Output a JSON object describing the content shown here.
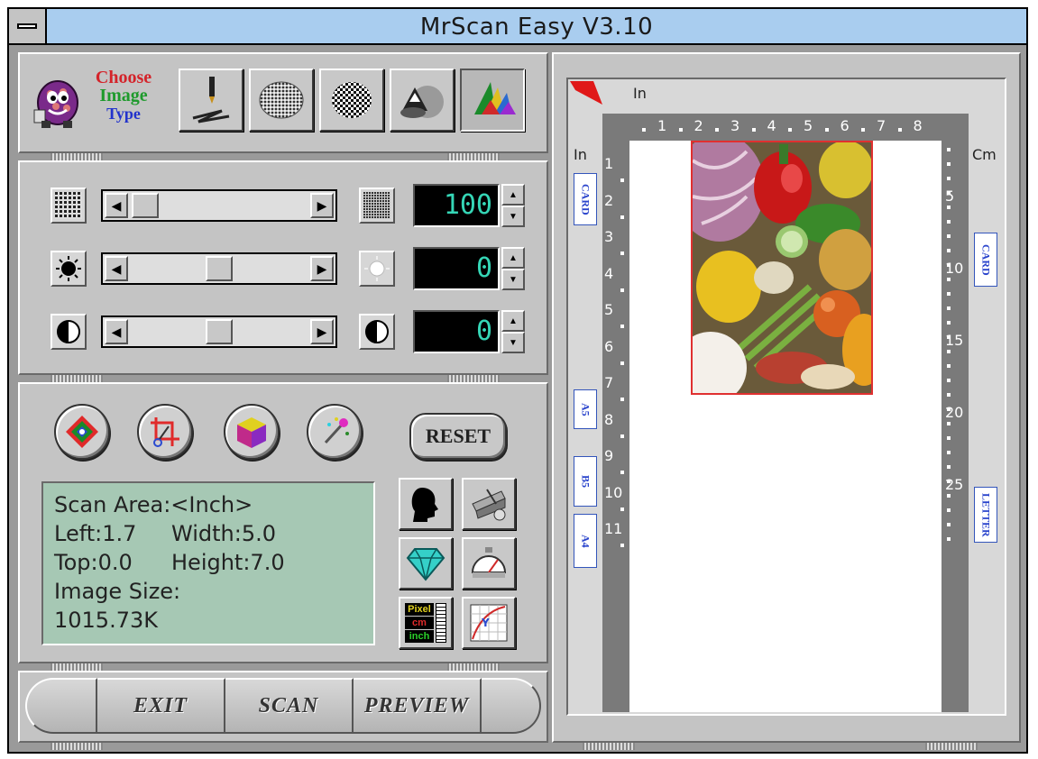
{
  "window": {
    "title": "MrScan Easy  V3.10"
  },
  "image_type": {
    "label_line1": "Choose",
    "label_line2": "Image",
    "label_line3": "Type",
    "colors": {
      "line1": "#d4232a",
      "line2": "#1e9a2c",
      "line3": "#2233cc"
    },
    "modes": [
      {
        "icon": "line-art-icon"
      },
      {
        "icon": "halftone-icon"
      },
      {
        "icon": "dither-icon"
      },
      {
        "icon": "grayscale-icon"
      },
      {
        "icon": "color-icon",
        "selected": true
      }
    ]
  },
  "adjustments": [
    {
      "name": "resolution",
      "left_icon": "low-resolution-icon",
      "right_icon": "high-resolution-icon",
      "value": "100",
      "level": 0.05
    },
    {
      "name": "brightness",
      "left_icon": "dark-sun-icon",
      "right_icon": "bright-sun-icon",
      "value": "0",
      "level": 0.5
    },
    {
      "name": "contrast",
      "left_icon": "contrast-low-icon",
      "right_icon": "contrast-high-icon",
      "value": "0",
      "level": 0.5
    }
  ],
  "tools": {
    "round_buttons": [
      {
        "icon": "color-balance-icon"
      },
      {
        "icon": "crop-icon"
      },
      {
        "icon": "color-cube-icon"
      },
      {
        "icon": "magic-wand-icon"
      }
    ],
    "reset_label": "RESET",
    "side_buttons": [
      {
        "icon": "profile-silhouette-icon"
      },
      {
        "icon": "scanner-tools-icon"
      },
      {
        "icon": "diamond-icon"
      },
      {
        "icon": "speedometer-icon"
      },
      {
        "icon": "unit-ruler-icon",
        "units": [
          "Pixel",
          "cm",
          "inch"
        ]
      },
      {
        "icon": "gamma-curve-icon"
      }
    ]
  },
  "scan_info": {
    "line1": "Scan Area:<Inch>",
    "left": "Left:1.7",
    "width": "Width:5.0",
    "top": "Top:0.0",
    "height": "Height:7.0",
    "line4": "Image Size:",
    "line5": "1015.73K"
  },
  "actions": {
    "exit": "EXIT",
    "scan": "SCAN",
    "preview": "PREVIEW"
  },
  "preview": {
    "top_unit": "In",
    "left_unit": "In",
    "right_unit": "Cm",
    "top_ticks": [
      "1",
      "2",
      "3",
      "4",
      "5",
      "6",
      "7",
      "8"
    ],
    "left_ticks": [
      "1",
      "2",
      "3",
      "4",
      "5",
      "6",
      "7",
      "8",
      "9",
      "10",
      "11"
    ],
    "right_ticks": [
      "5",
      "10",
      "15",
      "20",
      "25"
    ],
    "paper_sizes_left": [
      "CARD",
      "A5",
      "B5",
      "A4"
    ],
    "paper_sizes_right": [
      "CARD",
      "LETTER"
    ],
    "selection_color": "#e03030"
  }
}
